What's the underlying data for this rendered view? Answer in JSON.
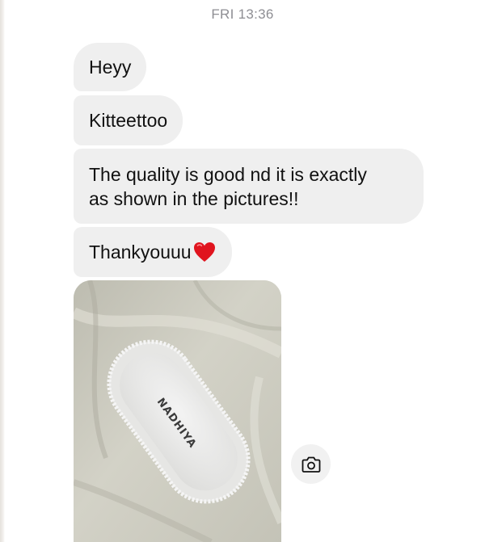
{
  "header": {
    "timestamp": "FRI 13:36"
  },
  "messages": [
    {
      "text": "Heyy"
    },
    {
      "text": "Kitteettoo"
    },
    {
      "line1": "The quality is good nd  it is exactly",
      "line2": "as shown in the pictures!!"
    },
    {
      "text": "Thankyouuu",
      "emoji": "heart-emoji"
    }
  ],
  "photo": {
    "tray_text": "NADHIYA"
  },
  "actions": {
    "camera_icon": "camera-icon"
  },
  "colors": {
    "bubble": "#efefef",
    "timestamp": "#8e8e93",
    "heart": "#e0141e"
  }
}
